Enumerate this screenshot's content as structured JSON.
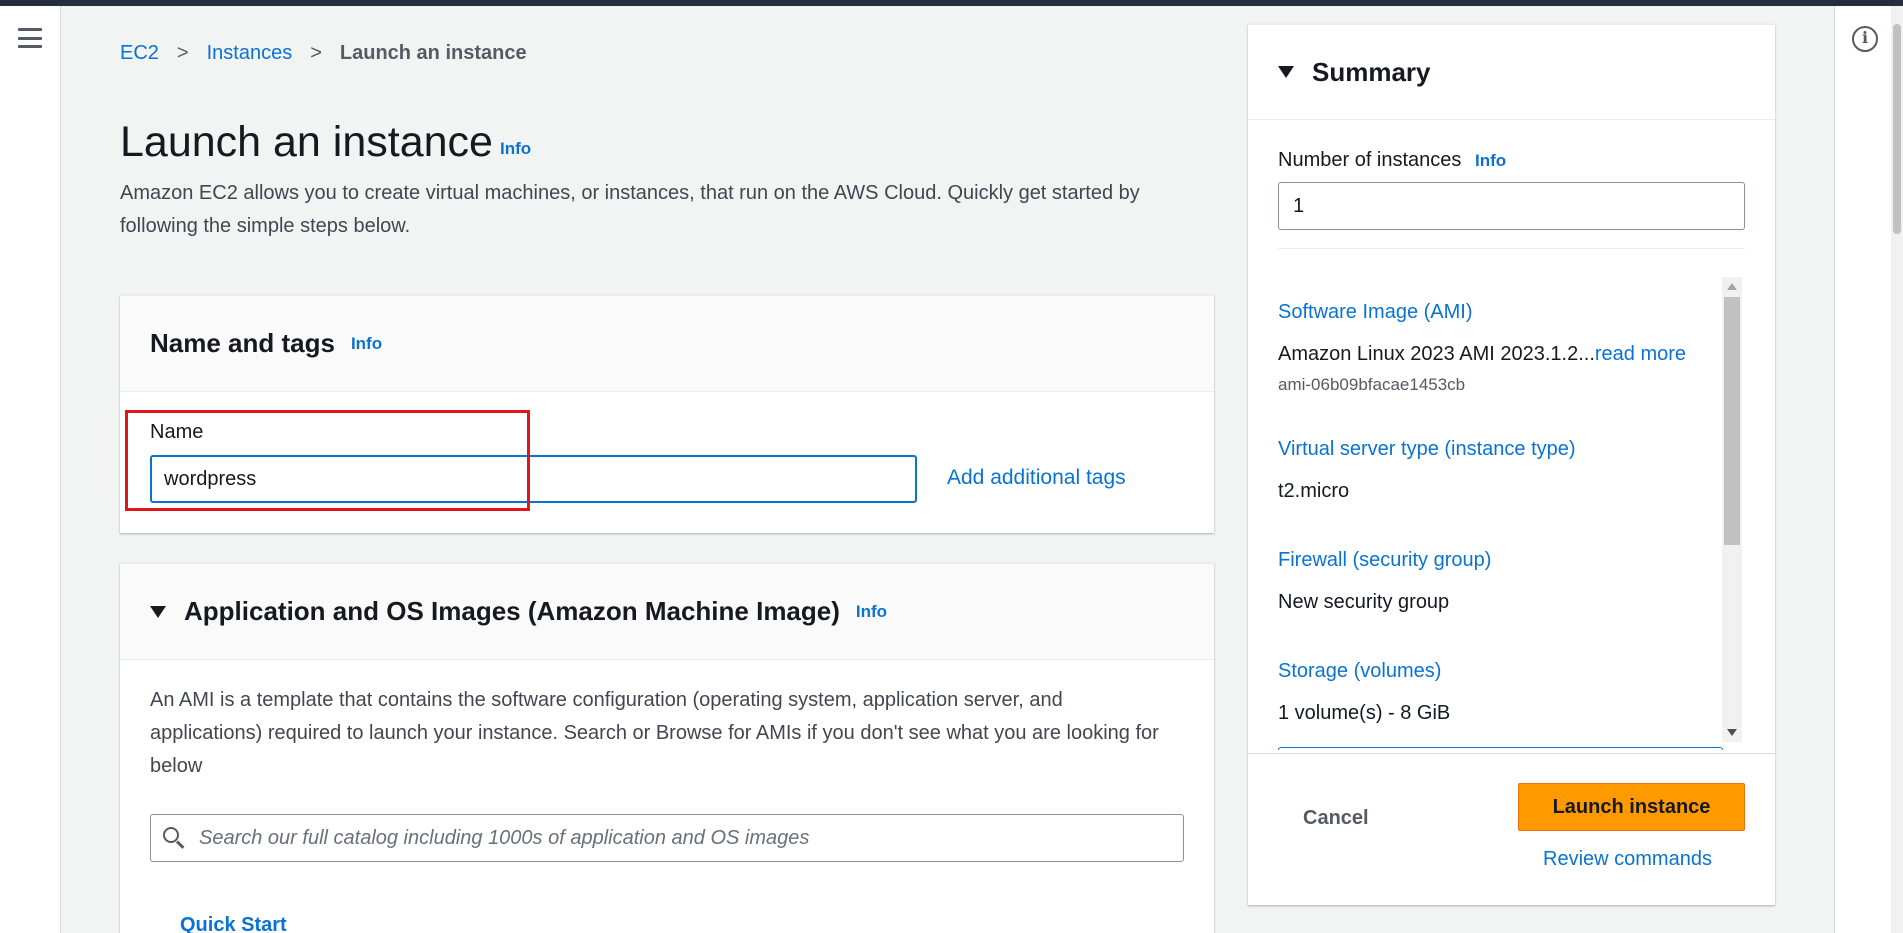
{
  "breadcrumb": {
    "items": [
      "EC2",
      "Instances"
    ],
    "current": "Launch an instance",
    "separator": ">"
  },
  "page": {
    "title": "Launch an instance",
    "title_info": "Info",
    "intro": "Amazon EC2 allows you to create virtual machines, or instances, that run on the AWS Cloud. Quickly get started by following the simple steps below."
  },
  "name_tags": {
    "title": "Name and tags",
    "info": "Info",
    "name_label": "Name",
    "name_value": "wordpress",
    "add_tags": "Add additional tags"
  },
  "ami": {
    "title": "Application and OS Images (Amazon Machine Image)",
    "info": "Info",
    "description": "An AMI is a template that contains the software configuration (operating system, application server, and applications) required to launch your instance. Search or Browse for AMIs if you don't see what you are looking for below",
    "search_placeholder": "Search our full catalog including 1000s of application and OS images",
    "quick_start": "Quick Start"
  },
  "summary": {
    "title": "Summary",
    "num_instances_label": "Number of instances",
    "num_instances_info": "Info",
    "num_instances_value": "1",
    "software_image_title": "Software Image (AMI)",
    "software_image_value": "Amazon Linux 2023 AMI 2023.1.2...",
    "software_image_read_more": "read more",
    "software_image_id": "ami-06b09bfacae1453cb",
    "server_type_title": "Virtual server type (instance type)",
    "server_type_value": "t2.micro",
    "firewall_title": "Firewall (security group)",
    "firewall_value": "New security group",
    "storage_title": "Storage (volumes)",
    "storage_value": "1 volume(s) - 8 GiB",
    "cancel": "Cancel",
    "launch": "Launch instance",
    "review": "Review commands"
  },
  "colors": {
    "link": "#0972d3",
    "primary_button": "#ff9900",
    "highlight": "#e0161c",
    "topbar": "#232f3e"
  },
  "icons": {
    "menu": "hamburger-menu-icon",
    "info": "info-circle-icon",
    "expand": "caret-down-icon",
    "search": "search-icon",
    "breadcrumb": "chevron-right-icon"
  }
}
